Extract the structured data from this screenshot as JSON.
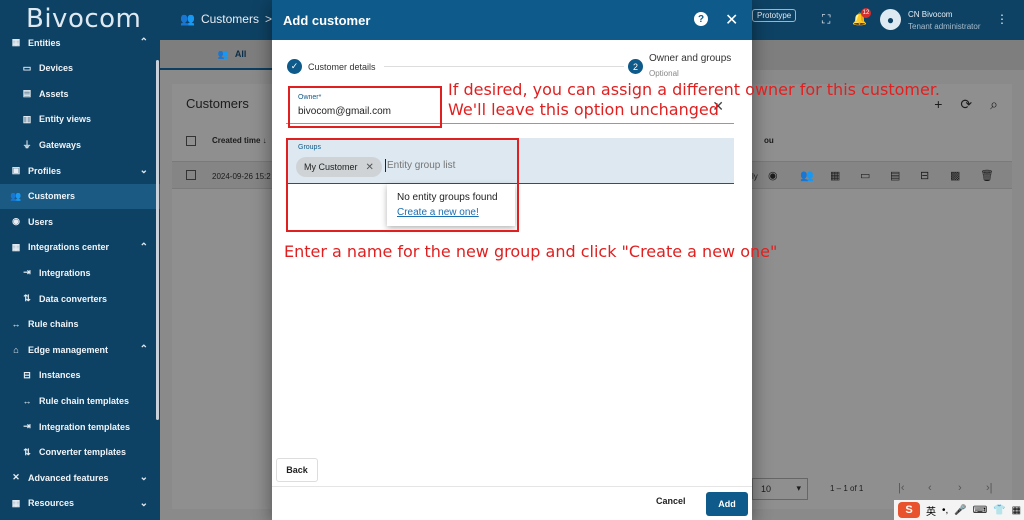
{
  "app": {
    "logo": "Bivocom"
  },
  "topbar": {
    "breadcrumb": "Customers",
    "breadcrumb_sep": ">",
    "prototype_label": "Prototype",
    "notification_count": "12",
    "user_name": "CN Bivocom",
    "user_role": "Tenant administrator"
  },
  "sidebar": {
    "items": [
      {
        "label": "Entities",
        "icon": "entities-icon",
        "level": 0,
        "chevron": "up"
      },
      {
        "label": "Devices",
        "icon": "devices-icon",
        "level": 1
      },
      {
        "label": "Assets",
        "icon": "assets-icon",
        "level": 1
      },
      {
        "label": "Entity views",
        "icon": "entity-views-icon",
        "level": 1
      },
      {
        "label": "Gateways",
        "icon": "gateways-icon",
        "level": 1
      },
      {
        "label": "Profiles",
        "icon": "profiles-icon",
        "level": 0,
        "chevron": "down"
      },
      {
        "label": "Customers",
        "icon": "customers-icon",
        "level": 0,
        "active": true
      },
      {
        "label": "Users",
        "icon": "users-icon",
        "level": 0
      },
      {
        "label": "Integrations center",
        "icon": "integrations-center-icon",
        "level": 0,
        "chevron": "up"
      },
      {
        "label": "Integrations",
        "icon": "integrations-icon",
        "level": 1
      },
      {
        "label": "Data converters",
        "icon": "data-converters-icon",
        "level": 1
      },
      {
        "label": "Rule chains",
        "icon": "rule-chains-icon",
        "level": 0
      },
      {
        "label": "Edge management",
        "icon": "edge-management-icon",
        "level": 0,
        "chevron": "up"
      },
      {
        "label": "Instances",
        "icon": "instances-icon",
        "level": 1
      },
      {
        "label": "Rule chain templates",
        "icon": "rule-chain-templates-icon",
        "level": 1
      },
      {
        "label": "Integration templates",
        "icon": "integration-templates-icon",
        "level": 1
      },
      {
        "label": "Converter templates",
        "icon": "converter-templates-icon",
        "level": 1
      },
      {
        "label": "Advanced features",
        "icon": "advanced-features-icon",
        "level": 0,
        "chevron": "down"
      },
      {
        "label": "Resources",
        "icon": "resources-icon",
        "level": 0,
        "chevron": "down"
      }
    ]
  },
  "main": {
    "tab_all": "All",
    "card_title": "Customers",
    "column_created": "Created time ↓",
    "column_partial": "ou",
    "row_date": "2024-09-26 15:2",
    "row_partial": "ly",
    "page_size": "10",
    "page_range": "1 – 1 of 1"
  },
  "dialog": {
    "title": "Add customer",
    "step1_label": "Customer details",
    "step2_number": "2",
    "step2_label": "Owner and groups",
    "step2_optional": "Optional",
    "owner_label": "Owner*",
    "owner_value": "bivocom@gmail.com",
    "groups_label": "Groups",
    "group_chip": "My Customer",
    "groups_placeholder": "Entity group list",
    "dropdown_empty": "No entity groups found",
    "dropdown_create": "Create a new one!",
    "back_label": "Back",
    "cancel_label": "Cancel",
    "add_label": "Add"
  },
  "annotations": {
    "owner_note_line1": "If desired, you can assign a different owner for this customer.",
    "owner_note_line2": "We'll leave this option unchanged",
    "groups_note": "Enter a name for the new group and click \"Create a new one\"",
    "color": "#e02020"
  },
  "tray": {
    "ime": "英",
    "ime_logo": "S"
  }
}
